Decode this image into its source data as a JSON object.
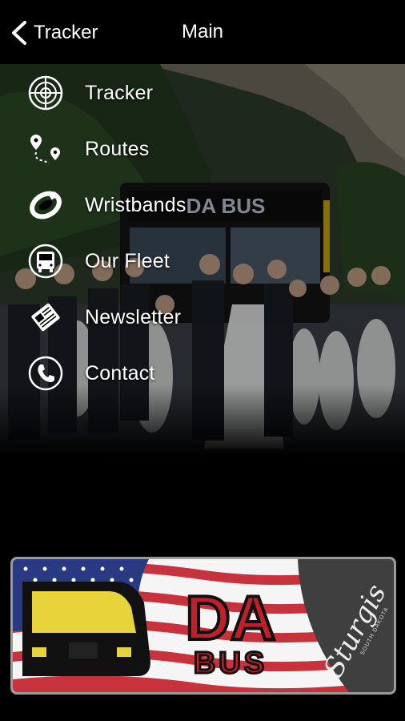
{
  "header": {
    "back_label": "Tracker",
    "title": "Main"
  },
  "menu": {
    "items": [
      {
        "label": "Tracker",
        "icon": "radar-icon"
      },
      {
        "label": "Routes",
        "icon": "route-pin-icon"
      },
      {
        "label": "Wristbands",
        "icon": "wristband-icon"
      },
      {
        "label": "Our Fleet",
        "icon": "bus-icon"
      },
      {
        "label": "Newsletter",
        "icon": "newsletter-icon"
      },
      {
        "label": "Contact",
        "icon": "phone-icon"
      }
    ]
  },
  "hero": {
    "bus_sign": "DA BUS"
  },
  "logo": {
    "brand_top": "DA",
    "brand_bottom": "BUS",
    "script_text": "Sturgis",
    "script_subtext": "SOUTH DAKOTA"
  }
}
